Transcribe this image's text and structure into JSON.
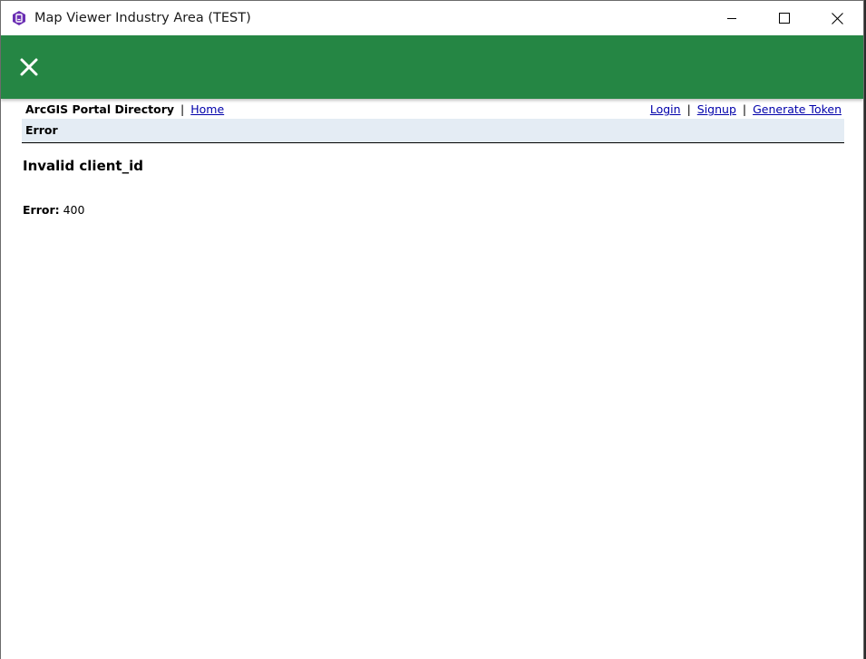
{
  "window": {
    "title": "Map Viewer Industry Area (TEST)",
    "icon": "app-hex-icon",
    "controls": [
      "minimize-icon",
      "maximize-icon",
      "close-icon"
    ]
  },
  "header": {
    "close_icon": "close-icon",
    "background_color": "#258644"
  },
  "portal": {
    "brand": "ArcGIS Portal Directory",
    "separator": "|",
    "home_link": "Home",
    "login_link": "Login",
    "signup_link": "Signup",
    "generate_token_link": "Generate Token",
    "section_title": "Error"
  },
  "error": {
    "message": "Invalid client_id",
    "label": "Error:",
    "code": "400"
  }
}
